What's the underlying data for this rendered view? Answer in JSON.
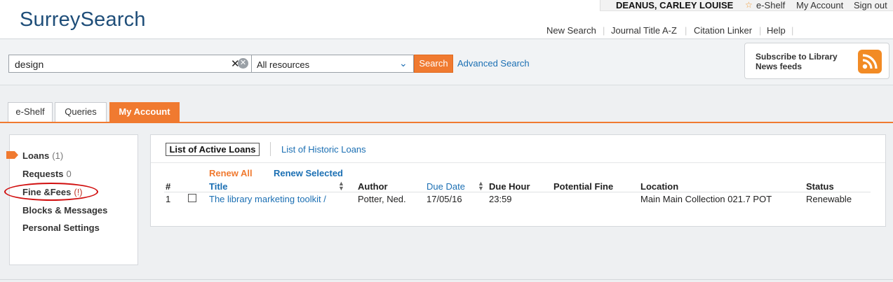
{
  "header": {
    "logo": "SurreySearch",
    "user_name": "DEANUS, CARLEY LOUISE",
    "eshelf": "e-Shelf",
    "my_account": "My Account",
    "sign_out": "Sign out",
    "nav": [
      "New Search",
      "Journal Title A-Z",
      "Citation Linker",
      "Help"
    ]
  },
  "search": {
    "query": "design",
    "scope": "All resources",
    "button": "Search",
    "advanced": "Advanced Search"
  },
  "rss": {
    "text": "Subscribe to Library News feeds"
  },
  "tabs": [
    "e-Shelf",
    "Queries",
    "My Account"
  ],
  "sidebar": {
    "loans": {
      "label": "Loans",
      "count": "(1)"
    },
    "requests": {
      "label": "Requests",
      "count": "0"
    },
    "fines": {
      "label": "Fine &Fees",
      "count": "(!)"
    },
    "blocks": "Blocks & Messages",
    "settings": "Personal Settings"
  },
  "loans": {
    "tab_active": "List of Active Loans",
    "tab_history": "List of Historic Loans",
    "renew_all": "Renew All",
    "renew_selected": "Renew Selected",
    "columns": {
      "num": "#",
      "title": "Title",
      "author": "Author",
      "due_date": "Due Date",
      "due_hour": "Due Hour",
      "potential_fine": "Potential Fine",
      "location": "Location",
      "status": "Status"
    },
    "rows": [
      {
        "num": "1",
        "title": "The library marketing toolkit /",
        "author": "Potter, Ned.",
        "due_date": "17/05/16",
        "due_hour": "23:59",
        "potential_fine": "",
        "location": "Main Main Collection 021.7 POT",
        "status": "Renewable"
      }
    ]
  },
  "colors": {
    "accent": "#f07a30",
    "link": "#1b6fb3",
    "logo": "#1f4e79",
    "annotation": "#d10e0e"
  }
}
